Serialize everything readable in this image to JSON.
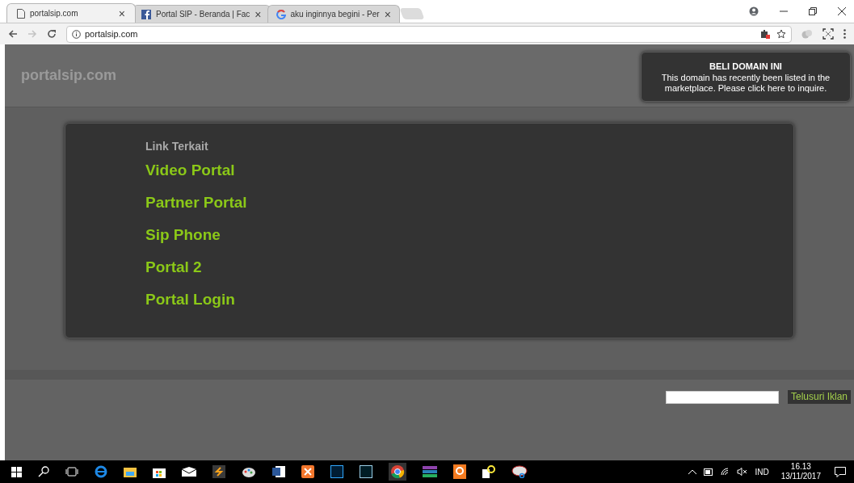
{
  "browser": {
    "tabs": [
      {
        "title": "portalsip.com",
        "kind": "page",
        "selected": true
      },
      {
        "title": "Portal SIP - Beranda | Fac",
        "kind": "facebook",
        "selected": false
      },
      {
        "title": "aku inginnya begini - Per",
        "kind": "google",
        "selected": false
      }
    ],
    "close_glyph": "×",
    "url": "portalsip.com"
  },
  "page": {
    "site_name": "portalsip.com",
    "banner": {
      "title": "BELI DOMAIN INI",
      "text": "This domain has recently been listed in the marketplace. Please click here to inquire."
    },
    "related": {
      "heading": "Link Terkait",
      "links": [
        "Video Portal",
        "Partner Portal",
        "Sip Phone",
        "Portal 2",
        "Portal Login"
      ]
    },
    "search_button": "Telusuri Iklan"
  },
  "taskbar": {
    "language": "IND",
    "time": "16.13",
    "date": "13/11/2017"
  }
}
